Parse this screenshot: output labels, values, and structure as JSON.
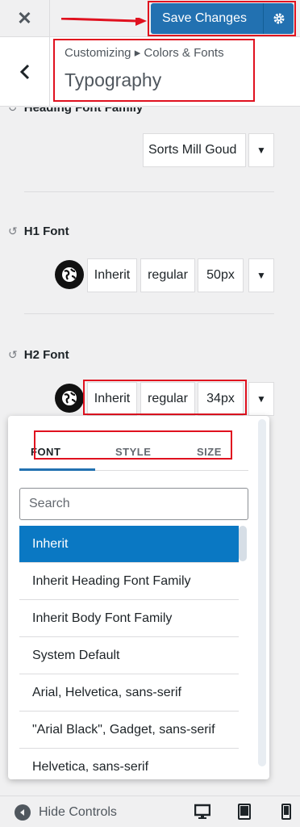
{
  "header": {
    "close_label": "✕",
    "save_label": "Save Changes"
  },
  "section": {
    "breadcrumb": "Customizing ▸ Colors & Fonts",
    "title": "Typography"
  },
  "heading_font_family": {
    "label": "Heading Font Family",
    "value": "Sorts Mill Goud"
  },
  "h1_font": {
    "label": "H1 Font",
    "family": "Inherit",
    "style": "regular",
    "size": "50px"
  },
  "h2_font": {
    "label": "H2 Font",
    "family": "Inherit",
    "style": "regular",
    "size": "34px"
  },
  "dropdown": {
    "tabs": [
      "FONT",
      "STYLE",
      "SIZE"
    ],
    "search_placeholder": "Search",
    "options": [
      "Inherit",
      "Inherit Heading Font Family",
      "Inherit Body Font Family",
      "System Default",
      "Arial, Helvetica, sans-serif",
      "\"Arial Black\", Gadget, sans-serif",
      "Helvetica, sans-serif"
    ],
    "selected_index": 0
  },
  "footer": {
    "hide_label": "Hide Controls"
  },
  "colors": {
    "primary": "#2271b1",
    "highlight": "#e0111f",
    "selected_option": "#0a78c3"
  }
}
